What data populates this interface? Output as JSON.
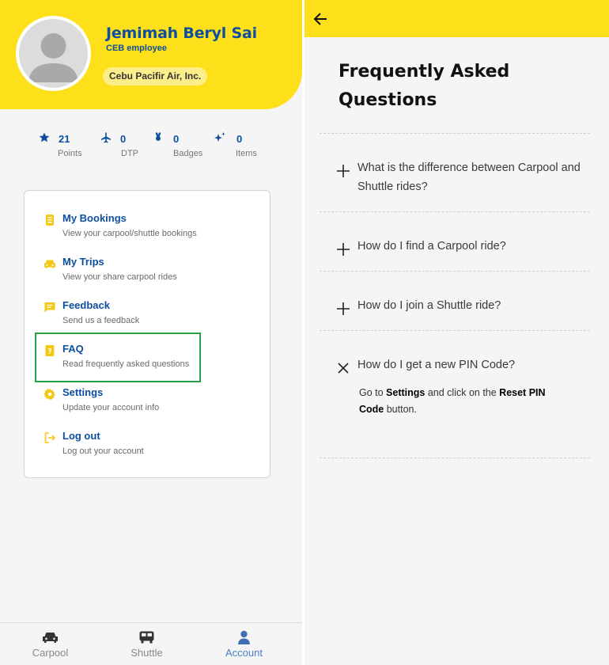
{
  "profile": {
    "name": "Jemimah Beryl Sai",
    "role": "CEB employee",
    "company": "Cebu Pacifir Air, Inc."
  },
  "stats": [
    {
      "icon": "star-icon",
      "value": "21",
      "label": "Points"
    },
    {
      "icon": "plane-icon",
      "value": "0",
      "label": "DTP"
    },
    {
      "icon": "medal-icon",
      "value": "0",
      "label": "Badges"
    },
    {
      "icon": "sparkle-icon",
      "value": "0",
      "label": "Items"
    }
  ],
  "menu": [
    {
      "icon": "bookings-icon",
      "title": "My Bookings",
      "subtitle": "View your carpool/shuttle bookings"
    },
    {
      "icon": "car-icon",
      "title": "My Trips",
      "subtitle": "View your share carpool rides"
    },
    {
      "icon": "feedback-icon",
      "title": "Feedback",
      "subtitle": "Send us a feedback"
    },
    {
      "icon": "faq-book-icon",
      "title": "FAQ",
      "subtitle": "Read frequently asked questions"
    },
    {
      "icon": "gear-icon",
      "title": "Settings",
      "subtitle": "Update your account info"
    },
    {
      "icon": "logout-icon",
      "title": "Log out",
      "subtitle": "Log out your account"
    }
  ],
  "nav": [
    {
      "icon": "carpool-icon",
      "label": "Carpool",
      "active": false
    },
    {
      "icon": "shuttle-icon",
      "label": "Shuttle",
      "active": false
    },
    {
      "icon": "account-icon",
      "label": "Account",
      "active": true
    }
  ],
  "faq": {
    "title": "Frequently Asked Questions",
    "questions": [
      {
        "question": "What is the difference between Carpool and Shuttle rides?",
        "expanded": false
      },
      {
        "question": "How do I find a Carpool ride?",
        "expanded": false
      },
      {
        "question": "How do I join a Shuttle ride?",
        "expanded": false
      },
      {
        "question": "How do I get a new PIN Code?",
        "expanded": true
      }
    ],
    "answer": {
      "part1": "Go to ",
      "bold1": "Settings",
      "part2": " and click on the ",
      "bold2": "Reset PIN Code",
      "part3": " button."
    }
  },
  "colors": {
    "brand_yellow": "#fde01a",
    "brand_blue": "#0d4e9e",
    "icon_yellow": "#f4c916",
    "highlight_green": "#27a045",
    "nav_active": "#4a7fc1"
  }
}
